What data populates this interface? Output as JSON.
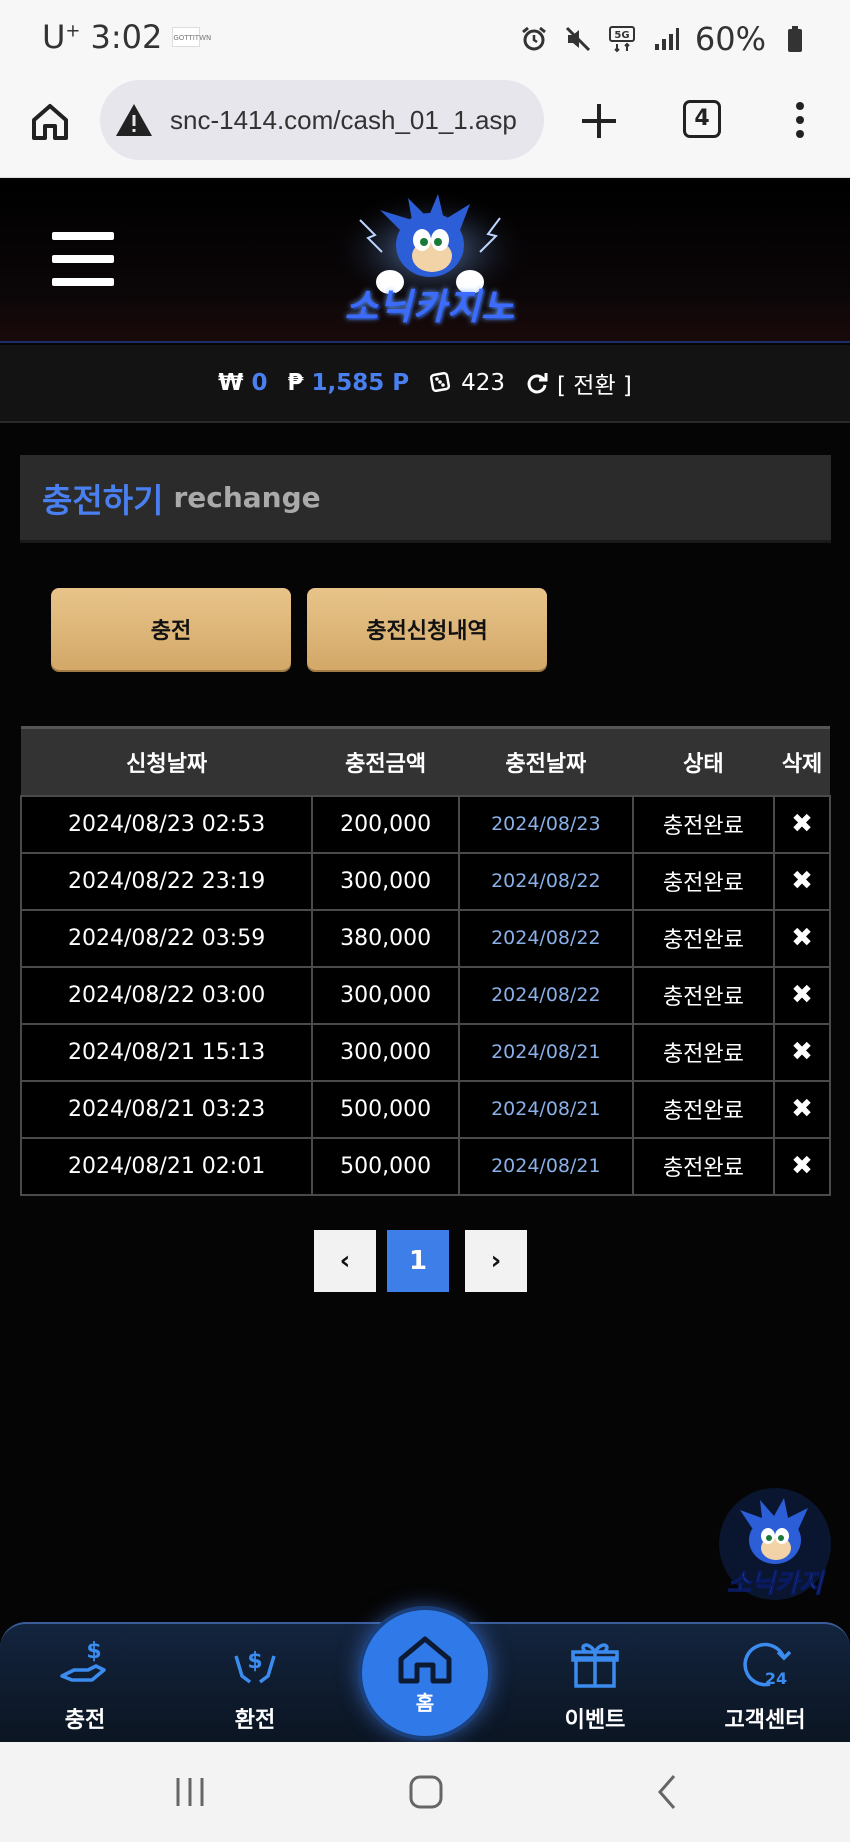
{
  "status_bar": {
    "carrier": "U",
    "carrier_sup": "+",
    "time": "3:02",
    "mini_app": "GOTTITWN",
    "battery": "60%"
  },
  "browser": {
    "url": "snc-1414.com/cash_01_1.asp",
    "tab_count": "4"
  },
  "header": {
    "logo_text": "소닉카지노"
  },
  "balance": {
    "won_symbol": "₩",
    "won_value": "0",
    "point_symbol": "₱",
    "point_value": "1,585 P",
    "dice_value": "423",
    "switch_label": "[ 전환 ]"
  },
  "section": {
    "title_ko": "충전하기",
    "title_en": "rechange"
  },
  "buttons": {
    "charge": "충전",
    "history": "충전신청내역"
  },
  "table": {
    "headers": [
      "신청날짜",
      "충전금액",
      "충전날짜",
      "상태",
      "삭제"
    ],
    "rows": [
      [
        "2024/08/23 02:53",
        "200,000",
        "2024/08/23",
        "충전완료",
        "✖"
      ],
      [
        "2024/08/22 23:19",
        "300,000",
        "2024/08/22",
        "충전완료",
        "✖"
      ],
      [
        "2024/08/22 03:59",
        "380,000",
        "2024/08/22",
        "충전완료",
        "✖"
      ],
      [
        "2024/08/22 03:00",
        "300,000",
        "2024/08/22",
        "충전완료",
        "✖"
      ],
      [
        "2024/08/21 15:13",
        "300,000",
        "2024/08/21",
        "충전완료",
        "✖"
      ],
      [
        "2024/08/21 03:23",
        "500,000",
        "2024/08/21",
        "충전완료",
        "✖"
      ],
      [
        "2024/08/21 02:01",
        "500,000",
        "2024/08/21",
        "충전완료",
        "✖"
      ]
    ]
  },
  "pagination": {
    "prev": "‹",
    "current": "1",
    "next": "›"
  },
  "floating": {
    "logo_text": "소닉카지"
  },
  "bottom_nav": {
    "charge": "충전",
    "exchange": "환전",
    "home": "홈",
    "event": "이벤트",
    "support": "고객센터"
  },
  "colors": {
    "accent_blue": "#4a7ff0",
    "gold_button": "#dfb77a",
    "page_bg": "#050505"
  }
}
